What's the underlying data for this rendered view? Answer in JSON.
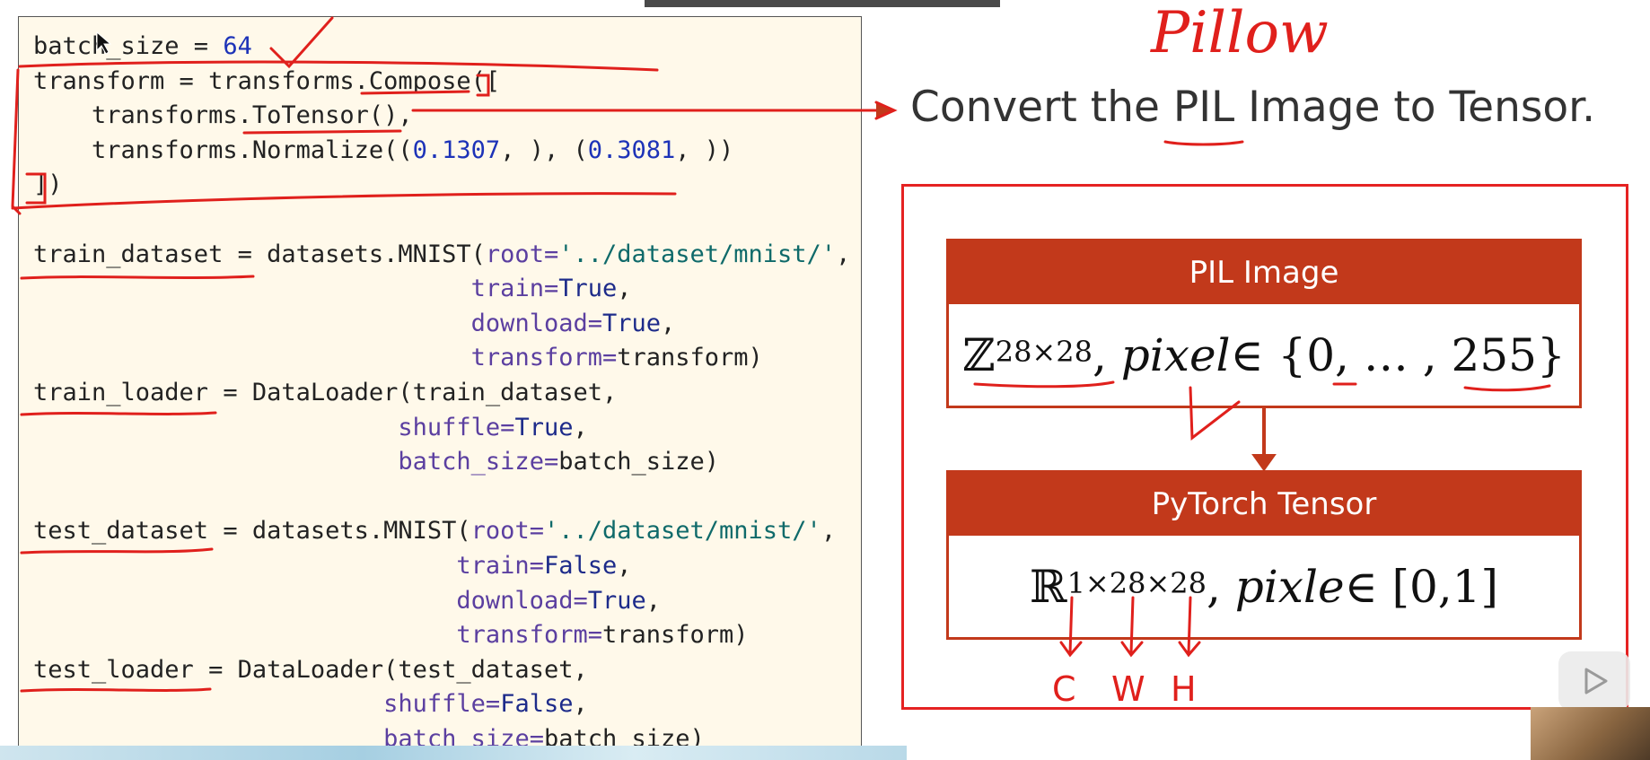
{
  "code": {
    "lines": [
      [
        {
          "t": "batch_size = ",
          "c": ""
        },
        {
          "t": "64",
          "c": "num"
        }
      ],
      [
        {
          "t": "transform = transforms.Compose([",
          "c": ""
        }
      ],
      [
        {
          "t": "    transforms.ToTensor(),",
          "c": ""
        }
      ],
      [
        {
          "t": "    transforms.Normalize((",
          "c": ""
        },
        {
          "t": "0.1307",
          "c": "num"
        },
        {
          "t": ", ), (",
          "c": ""
        },
        {
          "t": "0.3081",
          "c": "num"
        },
        {
          "t": ", ))",
          "c": ""
        }
      ],
      [
        {
          "t": "])",
          "c": ""
        }
      ],
      [
        {
          "t": "",
          "c": ""
        }
      ],
      [
        {
          "t": "train_dataset = datasets.MNIST(",
          "c": ""
        },
        {
          "t": "root=",
          "c": "par"
        },
        {
          "t": "'../dataset/mnist/'",
          "c": "str"
        },
        {
          "t": ",",
          "c": ""
        }
      ],
      [
        {
          "t": "                              ",
          "c": ""
        },
        {
          "t": "train=",
          "c": "par"
        },
        {
          "t": "True",
          "c": "kw"
        },
        {
          "t": ",",
          "c": ""
        }
      ],
      [
        {
          "t": "                              ",
          "c": ""
        },
        {
          "t": "download=",
          "c": "par"
        },
        {
          "t": "True",
          "c": "kw"
        },
        {
          "t": ",",
          "c": ""
        }
      ],
      [
        {
          "t": "                              ",
          "c": ""
        },
        {
          "t": "transform=",
          "c": "par"
        },
        {
          "t": "transform)",
          "c": ""
        }
      ],
      [
        {
          "t": "train_loader = DataLoader(train_dataset,",
          "c": ""
        }
      ],
      [
        {
          "t": "                         ",
          "c": ""
        },
        {
          "t": "shuffle=",
          "c": "par"
        },
        {
          "t": "True",
          "c": "kw"
        },
        {
          "t": ",",
          "c": ""
        }
      ],
      [
        {
          "t": "                         ",
          "c": ""
        },
        {
          "t": "batch_size=",
          "c": "par"
        },
        {
          "t": "batch_size)",
          "c": ""
        }
      ],
      [
        {
          "t": "",
          "c": ""
        }
      ],
      [
        {
          "t": "test_dataset = datasets.MNIST(",
          "c": ""
        },
        {
          "t": "root=",
          "c": "par"
        },
        {
          "t": "'../dataset/mnist/'",
          "c": "str"
        },
        {
          "t": ",",
          "c": ""
        }
      ],
      [
        {
          "t": "                             ",
          "c": ""
        },
        {
          "t": "train=",
          "c": "par"
        },
        {
          "t": "False",
          "c": "kw"
        },
        {
          "t": ",",
          "c": ""
        }
      ],
      [
        {
          "t": "                             ",
          "c": ""
        },
        {
          "t": "download=",
          "c": "par"
        },
        {
          "t": "True",
          "c": "kw"
        },
        {
          "t": ",",
          "c": ""
        }
      ],
      [
        {
          "t": "                             ",
          "c": ""
        },
        {
          "t": "transform=",
          "c": "par"
        },
        {
          "t": "transform)",
          "c": ""
        }
      ],
      [
        {
          "t": "test_loader = DataLoader(test_dataset,",
          "c": ""
        }
      ],
      [
        {
          "t": "                        ",
          "c": ""
        },
        {
          "t": "shuffle=",
          "c": "par"
        },
        {
          "t": "False",
          "c": "kw"
        },
        {
          "t": ",",
          "c": ""
        }
      ],
      [
        {
          "t": "                        ",
          "c": ""
        },
        {
          "t": "batch_size=",
          "c": "par"
        },
        {
          "t": "batch_size)",
          "c": ""
        }
      ]
    ]
  },
  "slide": {
    "caption": "Convert the PIL Image to Tensor.",
    "pil_block": {
      "title": "PIL Image",
      "set_symbol": "ℤ",
      "superscript": "28×28",
      "var": "pixel",
      "rest": " ∈ {0, … , 255}"
    },
    "tensor_block": {
      "title": "PyTorch Tensor",
      "set_symbol": "ℝ",
      "superscript": "1×28×28",
      "var": "pixle",
      "rest": " ∈ [0,1]"
    }
  },
  "annotations": {
    "pillow_note": "Pillow",
    "dim_labels": [
      "C",
      "W",
      "H"
    ],
    "ink_color": "#e0201c"
  },
  "colors": {
    "panel_bg": "#fff9ea",
    "block_color": "#c2391b",
    "frame_color": "#e52222"
  },
  "icons": {
    "play": "play-icon"
  }
}
